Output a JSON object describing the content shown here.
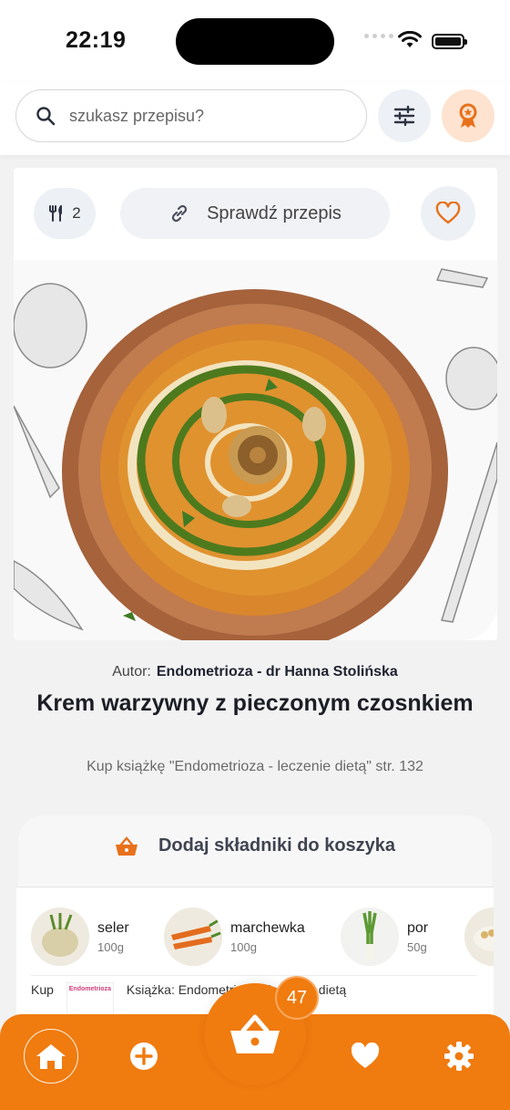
{
  "status_bar": {
    "time": "22:19"
  },
  "search": {
    "placeholder": "szukasz przepisu?"
  },
  "recipe": {
    "servings": "2",
    "check_recipe_label": "Sprawdź przepis",
    "author_label": "Autor:",
    "author_name": "Endometrioza - dr Hanna Stolińska",
    "title": "Krem warzywny z pieczonym czosnkiem",
    "book_ref": "Kup książkę \"Endometrioza - leczenie dietą\" str. 132"
  },
  "basket_section": {
    "label": "Dodaj składniki do koszyka"
  },
  "ingredients": [
    {
      "name": "seler",
      "amount": "100g"
    },
    {
      "name": "marchewka",
      "amount": "100g"
    },
    {
      "name": "por",
      "amount": "50g"
    }
  ],
  "buy_row": {
    "prefix": "Kup",
    "cover_title": "Endometrioza",
    "text": "Książka: Endometrioza - leczenie dietą"
  },
  "tabbar": {
    "basket_count": "47"
  },
  "colors": {
    "accent": "#f07b0f",
    "accent_light": "#fde3d0",
    "button_bg": "#edf0f5"
  },
  "icons": [
    "search-icon",
    "filter-icon",
    "award-icon",
    "cutlery-icon",
    "link-icon",
    "heart-outline-icon",
    "basket-icon",
    "home-icon",
    "plus-circle-icon",
    "heart-icon",
    "gear-icon"
  ]
}
